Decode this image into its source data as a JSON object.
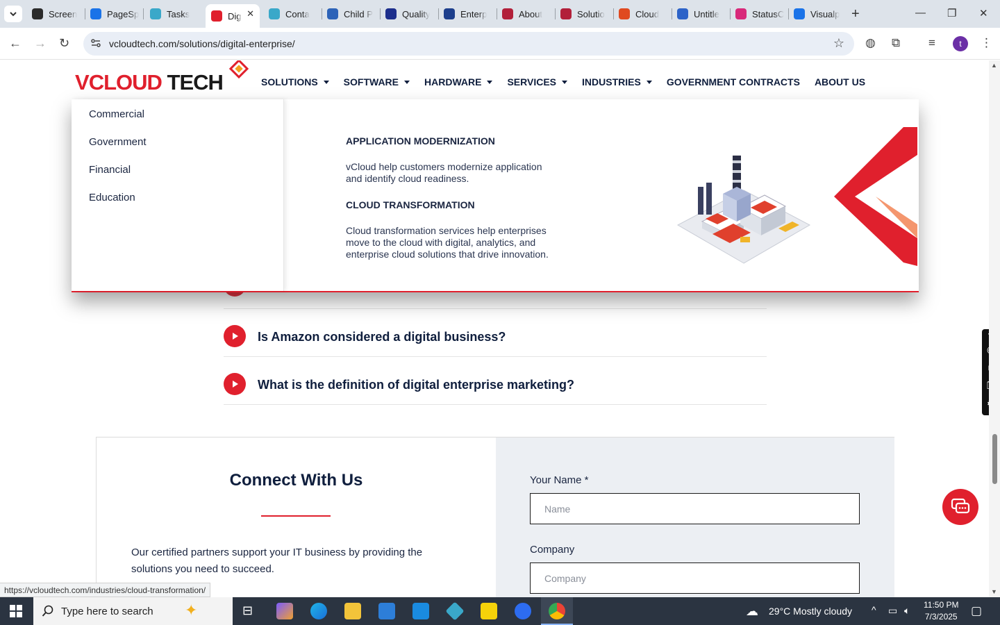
{
  "browser": {
    "tabs": [
      {
        "label": "Screen",
        "fav_color": "#2b2b2b",
        "left": 0
      },
      {
        "label": "PageSp",
        "fav_color": "#1a73e8"
      },
      {
        "label": "Tasks",
        "fav_color": "#3aa8c9"
      },
      {
        "label": "Dig",
        "fav_color": "#e0202d"
      },
      {
        "label": "Conta",
        "fav_color": "#3aa8c9"
      },
      {
        "label": "Child P",
        "fav_color": "#2d63b8"
      },
      {
        "label": "Quality",
        "fav_color": "#1c2e8c"
      },
      {
        "label": "Enterp",
        "fav_color": "#1c3e8c"
      },
      {
        "label": "About",
        "fav_color": "#b2203a"
      },
      {
        "label": "Solutio",
        "fav_color": "#b2203a"
      },
      {
        "label": "Cloud",
        "fav_color": "#e04a20"
      },
      {
        "label": "Untitle",
        "fav_color": "#2d63c8"
      },
      {
        "label": "StatusC",
        "fav_color": "#d8297a"
      },
      {
        "label": "Visualp",
        "fav_color": "#1a73e8"
      }
    ],
    "url": "vcloudtech.com/solutions/digital-enterprise/",
    "profile_initial": "t",
    "status_tip": "https://vcloudtech.com/industries/cloud-transformation/"
  },
  "site": {
    "logo": {
      "v": "V",
      "cloud": "CLOUD",
      "tech": " TECH"
    },
    "nav": [
      {
        "label": "SOLUTIONS",
        "caret": true
      },
      {
        "label": "SOFTWARE",
        "caret": true
      },
      {
        "label": "HARDWARE",
        "caret": true
      },
      {
        "label": "SERVICES",
        "caret": true
      },
      {
        "label": "INDUSTRIES",
        "caret": true
      },
      {
        "label": "GOVERNMENT CONTRACTS",
        "caret": false
      },
      {
        "label": "ABOUT US",
        "caret": false
      }
    ],
    "mega": {
      "links": [
        "Commercial",
        "Government",
        "Financial",
        "Education"
      ],
      "blocks": [
        {
          "title": "APPLICATION MODERNIZATION",
          "text": "vCloud help customers modernize application and identify cloud readiness."
        },
        {
          "title": "CLOUD TRANSFORMATION",
          "text": "Cloud transformation services help enterprises move to the cloud with digital, analytics, and enterprise cloud solutions that drive innovation."
        }
      ]
    },
    "faq": [
      "Is Amazon considered a digital business?",
      "What is the definition of digital enterprise marketing?"
    ],
    "connect": {
      "title": "Connect With Us",
      "text": "Our certified partners support your IT business by providing the solutions you need to succeed.",
      "form": {
        "name_label": "Your Name *",
        "name_placeholder": "Name",
        "company_label": "Company",
        "company_placeholder": "Company"
      }
    }
  },
  "taskbar": {
    "search_placeholder": "Type here to search",
    "weather": "29°C  Mostly cloudy",
    "time": "11:50 PM",
    "date": "7/3/2025"
  }
}
